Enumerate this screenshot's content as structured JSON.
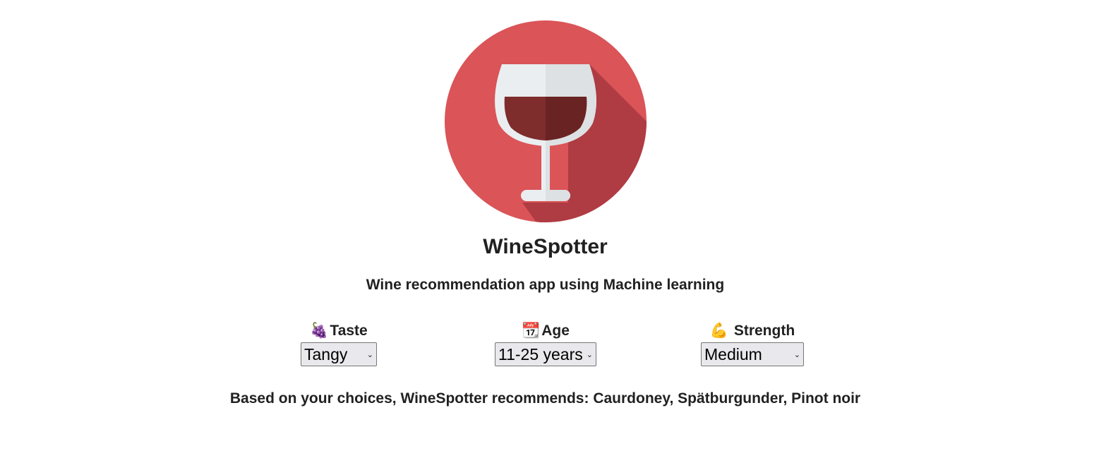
{
  "app": {
    "title": "WineSpotter",
    "subtitle": "Wine recommendation app using Machine learning"
  },
  "controls": {
    "taste": {
      "icon": "grapes-icon",
      "emoji": "🍇",
      "label": "Taste",
      "selected": "Tangy"
    },
    "age": {
      "icon": "calendar-icon",
      "emoji": "📆",
      "label": "Age",
      "selected": "11-25 years"
    },
    "strength": {
      "icon": "flexed-biceps-icon",
      "emoji": "💪",
      "label": "Strength",
      "selected": "Medium"
    }
  },
  "result": {
    "text": "Based on your choices, WineSpotter recommends: Caurdoney, Spätburgunder, Pinot noir"
  },
  "colors": {
    "logo_circle": "#DA5458",
    "logo_shadow": "#AF3B43",
    "glass": "#EBEEF0",
    "wine": "#7E2C2C"
  }
}
